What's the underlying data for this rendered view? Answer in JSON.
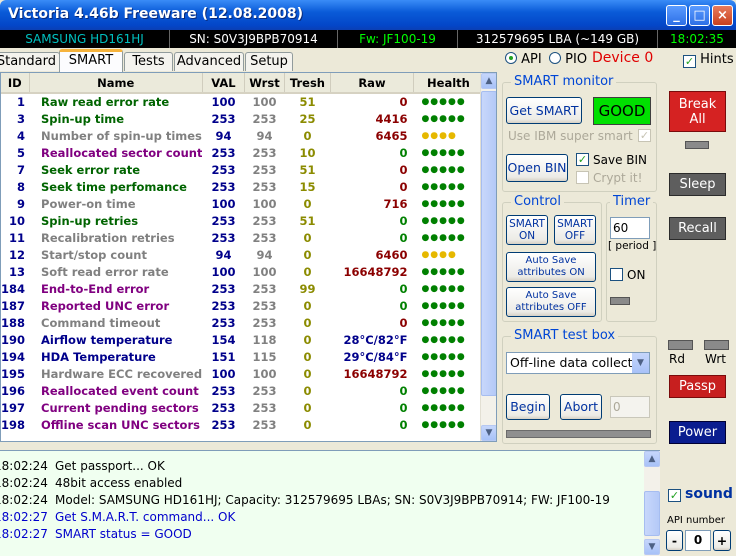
{
  "window": {
    "title": "Victoria 4.46b Freeware (12.08.2008)",
    "buttons": [
      "_",
      "□",
      "×"
    ]
  },
  "infobar": {
    "model": "SAMSUNG HD161HJ",
    "serial": "SN: S0V3J9BPB70914",
    "firmware": "Fw: JF100-19",
    "lba": "312579695 LBA (~149 GB)",
    "clock": "18:02:35"
  },
  "tabs": [
    "Standard",
    "SMART",
    "Tests",
    "Advanced",
    "Setup"
  ],
  "mode": {
    "api": "API",
    "pio": "PIO",
    "device": "Device 0",
    "hints": "Hints"
  },
  "table": {
    "headers": [
      "ID",
      "Name",
      "VAL",
      "Wrst",
      "Tresh",
      "Raw",
      "Health"
    ],
    "rows": [
      {
        "id": "1",
        "name": "Raw read error rate",
        "val": "100",
        "wrst": "100",
        "tresh": "51",
        "raw": "0",
        "health": "●●●●●",
        "name_color": "#006400",
        "raw_color": "#8B0000",
        "health_color": "#008000"
      },
      {
        "id": "3",
        "name": "Spin-up time",
        "val": "253",
        "wrst": "253",
        "tresh": "25",
        "raw": "4416",
        "health": "●●●●●",
        "name_color": "#006400",
        "raw_color": "#8B0000",
        "health_color": "#008000"
      },
      {
        "id": "4",
        "name": "Number of spin-up times",
        "val": "94",
        "wrst": "94",
        "tresh": "0",
        "raw": "6465",
        "health": "●●●●",
        "name_color": "#808080",
        "raw_color": "#8B0000",
        "health_color": "#E6B800"
      },
      {
        "id": "5",
        "name": "Reallocated sector count",
        "val": "253",
        "wrst": "253",
        "tresh": "10",
        "raw": "0",
        "health": "●●●●●",
        "name_color": "#800080",
        "raw_color": "#008000",
        "health_color": "#008000"
      },
      {
        "id": "7",
        "name": "Seek error rate",
        "val": "253",
        "wrst": "253",
        "tresh": "51",
        "raw": "0",
        "health": "●●●●●",
        "name_color": "#006400",
        "raw_color": "#8B0000",
        "health_color": "#008000"
      },
      {
        "id": "8",
        "name": "Seek time perfomance",
        "val": "253",
        "wrst": "253",
        "tresh": "15",
        "raw": "0",
        "health": "●●●●●",
        "name_color": "#006400",
        "raw_color": "#8B0000",
        "health_color": "#008000"
      },
      {
        "id": "9",
        "name": "Power-on time",
        "val": "100",
        "wrst": "100",
        "tresh": "0",
        "raw": "716",
        "health": "●●●●●",
        "name_color": "#808080",
        "raw_color": "#8B0000",
        "health_color": "#008000"
      },
      {
        "id": "10",
        "name": "Spin-up retries",
        "val": "253",
        "wrst": "253",
        "tresh": "51",
        "raw": "0",
        "health": "●●●●●",
        "name_color": "#006400",
        "raw_color": "#008000",
        "health_color": "#008000"
      },
      {
        "id": "11",
        "name": "Recalibration retries",
        "val": "253",
        "wrst": "253",
        "tresh": "0",
        "raw": "0",
        "health": "●●●●●",
        "name_color": "#808080",
        "raw_color": "#008000",
        "health_color": "#008000"
      },
      {
        "id": "12",
        "name": "Start/stop count",
        "val": "94",
        "wrst": "94",
        "tresh": "0",
        "raw": "6460",
        "health": "●●●●",
        "name_color": "#808080",
        "raw_color": "#8B0000",
        "health_color": "#E6B800"
      },
      {
        "id": "13",
        "name": "Soft read error rate",
        "val": "100",
        "wrst": "100",
        "tresh": "0",
        "raw": "16648792",
        "health": "●●●●●",
        "name_color": "#808080",
        "raw_color": "#8B0000",
        "health_color": "#008000"
      },
      {
        "id": "184",
        "name": "End-to-End error",
        "val": "253",
        "wrst": "253",
        "tresh": "99",
        "raw": "0",
        "health": "●●●●●",
        "name_color": "#800080",
        "raw_color": "#008000",
        "health_color": "#008000"
      },
      {
        "id": "187",
        "name": "Reported UNC error",
        "val": "253",
        "wrst": "253",
        "tresh": "0",
        "raw": "0",
        "health": "●●●●●",
        "name_color": "#800080",
        "raw_color": "#008000",
        "health_color": "#008000"
      },
      {
        "id": "188",
        "name": "Command timeout",
        "val": "253",
        "wrst": "253",
        "tresh": "0",
        "raw": "0",
        "health": "●●●●●",
        "name_color": "#808080",
        "raw_color": "#8B0000",
        "health_color": "#008000"
      },
      {
        "id": "190",
        "name": "Airflow temperature",
        "val": "154",
        "wrst": "118",
        "tresh": "0",
        "raw": "28°C/82°F",
        "health": "●●●●●",
        "name_color": "#00008B",
        "raw_color": "#00008B",
        "health_color": "#008000"
      },
      {
        "id": "194",
        "name": "HDA Temperature",
        "val": "151",
        "wrst": "115",
        "tresh": "0",
        "raw": "29°C/84°F",
        "health": "●●●●●",
        "name_color": "#00008B",
        "raw_color": "#00008B",
        "health_color": "#008000"
      },
      {
        "id": "195",
        "name": "Hardware ECC recovered",
        "val": "100",
        "wrst": "100",
        "tresh": "0",
        "raw": "16648792",
        "health": "●●●●●",
        "name_color": "#808080",
        "raw_color": "#8B0000",
        "health_color": "#008000"
      },
      {
        "id": "196",
        "name": "Reallocated event count",
        "val": "253",
        "wrst": "253",
        "tresh": "0",
        "raw": "0",
        "health": "●●●●●",
        "name_color": "#800080",
        "raw_color": "#008000",
        "health_color": "#008000"
      },
      {
        "id": "197",
        "name": "Current pending sectors",
        "val": "253",
        "wrst": "253",
        "tresh": "0",
        "raw": "0",
        "health": "●●●●●",
        "name_color": "#800080",
        "raw_color": "#008000",
        "health_color": "#008000"
      },
      {
        "id": "198",
        "name": "Offline scan UNC sectors",
        "val": "253",
        "wrst": "253",
        "tresh": "0",
        "raw": "0",
        "health": "●●●●●",
        "name_color": "#800080",
        "raw_color": "#008000",
        "health_color": "#008000"
      }
    ]
  },
  "smart_monitor": {
    "title": "SMART monitor",
    "get_smart": "Get SMART",
    "status": "GOOD",
    "ibm_label": "Use IBM super smart",
    "open_bin": "Open BIN",
    "save_bin": "Save BIN",
    "crypt": "Crypt it!"
  },
  "control": {
    "title": "Control",
    "smart_on_1": "SMART",
    "smart_on_2": "ON",
    "smart_off_1": "SMART",
    "smart_off_2": "OFF",
    "autosave_on_1": "Auto Save",
    "autosave_on_2": "attributes ON",
    "autosave_off_1": "Auto Save",
    "autosave_off_2": "attributes OFF"
  },
  "timer": {
    "title": "Timer",
    "value": "60",
    "period": "[ period ]",
    "on_label": "ON"
  },
  "test_box": {
    "title": "SMART test box",
    "selected": "Off-line data collect",
    "begin": "Begin",
    "abort": "Abort",
    "progress": "0"
  },
  "side": {
    "break_1": "Break",
    "break_2": "All",
    "sleep": "Sleep",
    "recall": "Recall",
    "rd": "Rd",
    "wrt": "Wrt",
    "passp": "Passp",
    "power": "Power",
    "sound": "sound",
    "api_number_label": "API number",
    "api_number": "0",
    "minus": "-",
    "plus": "+"
  },
  "log": [
    {
      "time": "18:02:24",
      "msg": "Get passport... OK",
      "color": "#000000"
    },
    {
      "time": "18:02:24",
      "msg": "48bit access enabled",
      "color": "#000000"
    },
    {
      "time": "18:02:24",
      "msg": "Model: SAMSUNG HD161HJ; Capacity: 312579695 LBAs; SN: S0V3J9BPB70914; FW: JF100-19",
      "color": "#000000"
    },
    {
      "time": "18:02:27",
      "msg": "Get S.M.A.R.T. command... OK",
      "color": "#0000CC"
    },
    {
      "time": "18:02:27",
      "msg": "SMART status = GOOD",
      "color": "#0000CC"
    }
  ],
  "colors": {
    "infobar_model": "#00C0C0",
    "infobar_serial": "#FFFFFF",
    "infobar_fw": "#00FF00",
    "infobar_lba": "#FFFFFF",
    "infobar_clock": "#00FF00",
    "good_bg": "#00E000",
    "device": "#E00000",
    "break_bg": "#D52222",
    "passp_bg": "#C71F1F",
    "power_bg": "#0A1D8F",
    "dark_btn_bg": "#5E5E5E"
  }
}
